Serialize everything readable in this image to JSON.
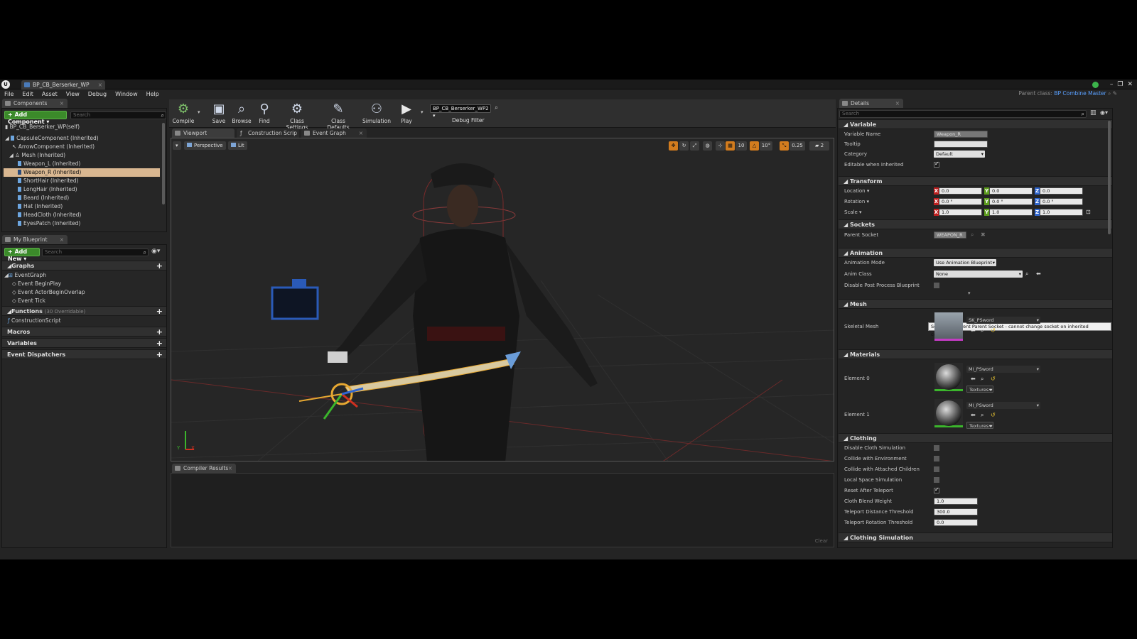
{
  "window": {
    "doc_tab": "BP_CB_Berserker_WP",
    "controls": [
      "–",
      "❐",
      "✕"
    ]
  },
  "menu": [
    "File",
    "Edit",
    "Asset",
    "View",
    "Debug",
    "Window",
    "Help"
  ],
  "parent_class": {
    "label": "Parent class:",
    "value": "BP Combine Master"
  },
  "components": {
    "tab": "Components",
    "add_button": "+ Add Component ▾",
    "search_placeholder": "Search",
    "self": "BP_CB_Berserker_WP(self)",
    "items": [
      "CapsuleComponent (Inherited)",
      "ArrowComponent (Inherited)",
      "Mesh (Inherited)",
      "Weapon_L (Inherited)",
      "Weapon_R (Inherited)",
      "ShortHair (Inherited)",
      "LongHair (Inherited)",
      "Beard (Inherited)",
      "Hat (Inherited)",
      "HeadCloth (Inherited)",
      "EyesPatch (Inherited)"
    ]
  },
  "my_blueprint": {
    "tab": "My Blueprint",
    "add_button": "+ Add New ▾",
    "search_placeholder": "Search",
    "graphs_label": "Graphs",
    "event_graph": "EventGraph",
    "events": [
      "Event BeginPlay",
      "Event ActorBeginOverlap",
      "Event Tick"
    ],
    "functions_label": "Functions",
    "functions_count": "(30 Overridable)",
    "construction_script": "ConstructionScript",
    "macros_label": "Macros",
    "variables_label": "Variables",
    "dispatchers_label": "Event Dispatchers"
  },
  "toolbar": {
    "buttons": [
      "Compile",
      "Save",
      "Browse",
      "Find",
      "Class Settings",
      "Class Defaults",
      "Simulation",
      "Play"
    ],
    "debug_object": "BP_CB_Berserker_WP2",
    "debug_filter": "Debug Filter"
  },
  "editor_tabs": [
    "Viewport",
    "Construction Scrip",
    "Event Graph"
  ],
  "viewport": {
    "perspective": "Perspective",
    "lit": "Lit",
    "snap_location": "10",
    "snap_rotation": "10°",
    "snap_scale": "0.25",
    "camera_speed": "2",
    "axis_x": "X",
    "axis_y": "Y"
  },
  "compiler": {
    "tab": "Compiler Results",
    "clear": "Clear"
  },
  "details": {
    "tab": "Details",
    "search_placeholder": "Search",
    "variable": {
      "header": "Variable",
      "name_label": "Variable Name",
      "name_value": "Weapon_R",
      "tooltip_label": "Tooltip",
      "tooltip_value": "",
      "category_label": "Category",
      "category_value": "Default",
      "editable_label": "Editable when Inherited",
      "editable": true
    },
    "transform": {
      "header": "Transform",
      "location_label": "Location ▾",
      "location": [
        "0.0",
        "0.0",
        "0.0"
      ],
      "rotation_label": "Rotation ▾",
      "rotation": [
        "0.0 °",
        "0.0 °",
        "0.0 °"
      ],
      "scale_label": "Scale ▾",
      "scale": [
        "1.0",
        "1.0",
        "1.0"
      ]
    },
    "sockets": {
      "header": "Sockets",
      "parent_label": "Parent Socket",
      "parent_value": "WEAPON_R"
    },
    "tooltip_text": "Select a different Parent Socket - cannot change socket on inherited components",
    "animation": {
      "header": "Animation",
      "mode_label": "Animation Mode",
      "mode_value": "Use Animation Blueprint",
      "class_label": "Anim Class",
      "class_value": "None",
      "disable_pp_label": "Disable Post Process Blueprint"
    },
    "mesh": {
      "header": "Mesh",
      "label": "Skeletal Mesh",
      "value": "SK_PSword"
    },
    "materials": {
      "header": "Materials",
      "elements": [
        {
          "label": "Element 0",
          "value": "MI_PSword",
          "textures": "Textures ▾"
        },
        {
          "label": "Element 1",
          "value": "MI_PSword",
          "textures": "Textures ▾"
        }
      ]
    },
    "clothing": {
      "header": "Clothing",
      "checks": [
        {
          "label": "Disable Cloth Simulation",
          "on": false
        },
        {
          "label": "Collide with Environment",
          "on": false
        },
        {
          "label": "Collide with Attached Children",
          "on": false
        },
        {
          "label": "Local Space Simulation",
          "on": false
        },
        {
          "label": "Reset After Teleport",
          "on": true
        }
      ],
      "blend_label": "Cloth Blend Weight",
      "blend_value": "1.0",
      "dist_label": "Teleport Distance Threshold",
      "dist_value": "300.0",
      "rot_label": "Teleport Rotation Threshold",
      "rot_value": "0.0"
    },
    "clothing_sim_header": "Clothing Simulation"
  }
}
